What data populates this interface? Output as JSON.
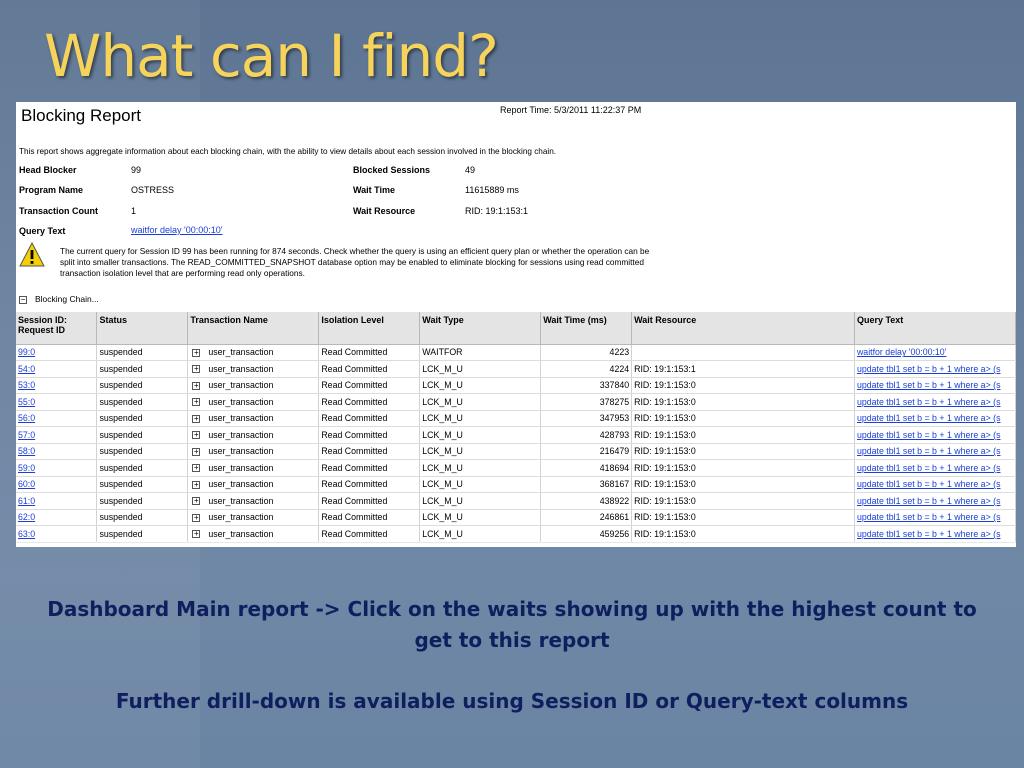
{
  "slide": {
    "title": "What can I find?",
    "note_line1": "Dashboard Main report -> Click on the waits showing up with the highest count to get to this report",
    "note_line2": "Further drill-down is available using Session ID or Query-text columns"
  },
  "report": {
    "title": "Blocking Report",
    "report_time": "Report Time: 5/3/2011 11:22:37 PM",
    "description": "This report shows aggregate information about each blocking chain, with the ability to view details about each session involved in the blocking chain.",
    "fields": {
      "head_blocker_label": "Head Blocker",
      "head_blocker": "99",
      "program_name_label": "Program Name",
      "program_name": "OSTRESS",
      "transaction_count_label": "Transaction Count",
      "transaction_count": "1",
      "query_text_label": "Query Text",
      "query_text": "waitfor delay '00:00:10'",
      "blocked_sessions_label": "Blocked Sessions",
      "blocked_sessions": "49",
      "wait_time_label": "Wait Time",
      "wait_time": "11615889 ms",
      "wait_resource_label": "Wait Resource",
      "wait_resource": "RID: 19:1:153:1"
    },
    "warning_icon": "warning-triangle-icon",
    "warning_text": "The current query for Session ID 99 has been running for 874 seconds. Check whether the query is using an efficient query plan or whether the operation can be split into smaller transactions. The READ_COMMITTED_SNAPSHOT database option may be enabled to eliminate blocking for sessions using read committed transaction isolation level that are performing read only operations.",
    "blocking_chain_label": "Blocking Chain...",
    "table": {
      "headers": {
        "session": "Session ID: Request ID",
        "status": "Status",
        "transaction_name": "Transaction Name",
        "isolation_level": "Isolation Level",
        "wait_type": "Wait Type",
        "wait_time": "Wait Time (ms)",
        "wait_resource": "Wait Resource",
        "query_text": "Query Text"
      },
      "rows": [
        {
          "session": "99:0",
          "status": "suspended",
          "txn": "user_transaction",
          "iso": "Read Committed",
          "wtype": "WAITFOR",
          "wtime": "4223",
          "wres": "",
          "query": "waitfor delay '00:00:10'"
        },
        {
          "session": "54:0",
          "status": "suspended",
          "txn": "user_transaction",
          "iso": "Read Committed",
          "wtype": "LCK_M_U",
          "wtime": "4224",
          "wres": "RID: 19:1:153:1",
          "query": "update tbl1 set b = b + 1 where a> (s"
        },
        {
          "session": "53:0",
          "status": "suspended",
          "txn": "user_transaction",
          "iso": "Read Committed",
          "wtype": "LCK_M_U",
          "wtime": "337840",
          "wres": "RID: 19:1:153:0",
          "query": "update tbl1 set b = b + 1 where a> (s"
        },
        {
          "session": "55:0",
          "status": "suspended",
          "txn": "user_transaction",
          "iso": "Read Committed",
          "wtype": "LCK_M_U",
          "wtime": "378275",
          "wres": "RID: 19:1:153:0",
          "query": "update tbl1 set b = b + 1 where a> (s"
        },
        {
          "session": "56:0",
          "status": "suspended",
          "txn": "user_transaction",
          "iso": "Read Committed",
          "wtype": "LCK_M_U",
          "wtime": "347953",
          "wres": "RID: 19:1:153:0",
          "query": "update tbl1 set b = b + 1 where a> (s"
        },
        {
          "session": "57:0",
          "status": "suspended",
          "txn": "user_transaction",
          "iso": "Read Committed",
          "wtype": "LCK_M_U",
          "wtime": "428793",
          "wres": "RID: 19:1:153:0",
          "query": "update tbl1 set b = b + 1 where a> (s"
        },
        {
          "session": "58:0",
          "status": "suspended",
          "txn": "user_transaction",
          "iso": "Read Committed",
          "wtype": "LCK_M_U",
          "wtime": "216479",
          "wres": "RID: 19:1:153:0",
          "query": "update tbl1 set b = b + 1 where a> (s"
        },
        {
          "session": "59:0",
          "status": "suspended",
          "txn": "user_transaction",
          "iso": "Read Committed",
          "wtype": "LCK_M_U",
          "wtime": "418694",
          "wres": "RID: 19:1:153:0",
          "query": "update tbl1 set b = b + 1 where a> (s"
        },
        {
          "session": "60:0",
          "status": "suspended",
          "txn": "user_transaction",
          "iso": "Read Committed",
          "wtype": "LCK_M_U",
          "wtime": "368167",
          "wres": "RID: 19:1:153:0",
          "query": "update tbl1 set b = b + 1 where a> (s"
        },
        {
          "session": "61:0",
          "status": "suspended",
          "txn": "user_transaction",
          "iso": "Read Committed",
          "wtype": "LCK_M_U",
          "wtime": "438922",
          "wres": "RID: 19:1:153:0",
          "query": "update tbl1 set b = b + 1 where a> (s"
        },
        {
          "session": "62:0",
          "status": "suspended",
          "txn": "user_transaction",
          "iso": "Read Committed",
          "wtype": "LCK_M_U",
          "wtime": "246861",
          "wres": "RID: 19:1:153:0",
          "query": "update tbl1 set b = b + 1 where a> (s"
        },
        {
          "session": "63:0",
          "status": "suspended",
          "txn": "user_transaction",
          "iso": "Read Committed",
          "wtype": "LCK_M_U",
          "wtime": "459256",
          "wres": "RID: 19:1:153:0",
          "query": "update tbl1 set b = b + 1 where a> (s"
        }
      ]
    }
  }
}
